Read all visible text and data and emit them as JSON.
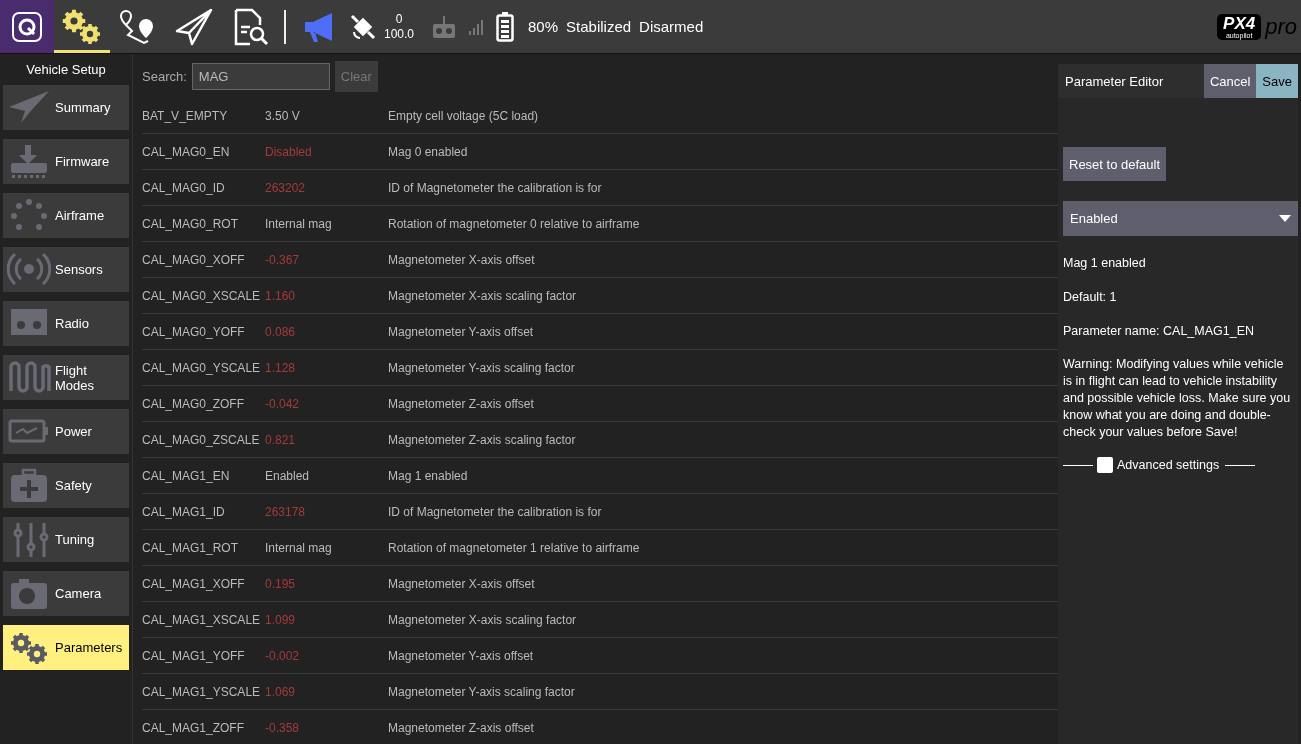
{
  "toolbar": {
    "tools": [
      {
        "selected": true
      },
      {
        "selected": false
      },
      {
        "selected": false
      },
      {
        "selected": false
      }
    ],
    "gps_count": "0",
    "hdop": "100.0",
    "battery": "80%",
    "flight_mode": "Stabilized",
    "arm_state": "Disarmed",
    "logo": {
      "brand": "PX4",
      "tagline": "autopilot",
      "edition": "pro"
    }
  },
  "sidebar": {
    "title": "Vehicle Setup",
    "items": [
      {
        "label": "Summary",
        "selected": false
      },
      {
        "label": "Firmware",
        "selected": false
      },
      {
        "label": "Airframe",
        "selected": false
      },
      {
        "label": "Sensors",
        "selected": false
      },
      {
        "label": "Radio",
        "selected": false
      },
      {
        "label": "Flight Modes",
        "selected": false
      },
      {
        "label": "Power",
        "selected": false
      },
      {
        "label": "Safety",
        "selected": false
      },
      {
        "label": "Tuning",
        "selected": false
      },
      {
        "label": "Camera",
        "selected": false
      },
      {
        "label": "Parameters",
        "selected": true
      }
    ]
  },
  "search": {
    "label": "Search:",
    "value": "MAG",
    "clear": {
      "label": "Clear",
      "disabled": true
    }
  },
  "table": {
    "rows": [
      {
        "name": "BAT_V_EMPTY",
        "value": "3.50 V",
        "modified": false,
        "description": "Empty cell voltage (5C load)"
      },
      {
        "name": "CAL_MAG0_EN",
        "value": "Disabled",
        "modified": true,
        "description": "Mag 0 enabled"
      },
      {
        "name": "CAL_MAG0_ID",
        "value": "263202",
        "modified": true,
        "description": "ID of Magnetometer the calibration is for"
      },
      {
        "name": "CAL_MAG0_ROT",
        "value": "Internal mag",
        "modified": false,
        "description": "Rotation of magnetometer 0 relative to airframe"
      },
      {
        "name": "CAL_MAG0_XOFF",
        "value": "-0.367",
        "modified": true,
        "description": "Magnetometer X-axis offset"
      },
      {
        "name": "CAL_MAG0_XSCALE",
        "value": "1.160",
        "modified": true,
        "description": "Magnetometer X-axis scaling factor"
      },
      {
        "name": "CAL_MAG0_YOFF",
        "value": "0.086",
        "modified": true,
        "description": "Magnetometer Y-axis offset"
      },
      {
        "name": "CAL_MAG0_YSCALE",
        "value": "1.128",
        "modified": true,
        "description": "Magnetometer Y-axis scaling factor"
      },
      {
        "name": "CAL_MAG0_ZOFF",
        "value": "-0.042",
        "modified": true,
        "description": "Magnetometer Z-axis offset"
      },
      {
        "name": "CAL_MAG0_ZSCALE",
        "value": "0.821",
        "modified": true,
        "description": "Magnetometer Z-axis scaling factor"
      },
      {
        "name": "CAL_MAG1_EN",
        "value": "Enabled",
        "modified": false,
        "description": "Mag 1 enabled"
      },
      {
        "name": "CAL_MAG1_ID",
        "value": "263178",
        "modified": true,
        "description": "ID of Magnetometer the calibration is for"
      },
      {
        "name": "CAL_MAG1_ROT",
        "value": "Internal mag",
        "modified": false,
        "description": "Rotation of magnetometer 1 relative to airframe"
      },
      {
        "name": "CAL_MAG1_XOFF",
        "value": "0.195",
        "modified": true,
        "description": "Magnetometer X-axis offset"
      },
      {
        "name": "CAL_MAG1_XSCALE",
        "value": "1.099",
        "modified": true,
        "description": "Magnetometer X-axis scaling factor"
      },
      {
        "name": "CAL_MAG1_YOFF",
        "value": "-0.002",
        "modified": true,
        "description": "Magnetometer Y-axis offset"
      },
      {
        "name": "CAL_MAG1_YSCALE",
        "value": "1.069",
        "modified": true,
        "description": "Magnetometer Y-axis scaling factor"
      },
      {
        "name": "CAL_MAG1_ZOFF",
        "value": "-0.358",
        "modified": true,
        "description": "Magnetometer Z-axis offset"
      }
    ]
  },
  "editor": {
    "title": "Parameter Editor",
    "cancel": "Cancel",
    "save": "Save",
    "reset": "Reset to default",
    "dropdown": {
      "value": "Enabled"
    },
    "description": "Mag 1 enabled",
    "default": "Default: 1",
    "param_name": "Parameter name: CAL_MAG1_EN",
    "warning": "Warning: Modifying values while vehicle is in flight can lead to vehicle instability and possible vehicle loss. Make sure you know what you are doing and double-check your values before Save!",
    "advanced": {
      "label": "Advanced settings",
      "checked": false
    }
  }
}
